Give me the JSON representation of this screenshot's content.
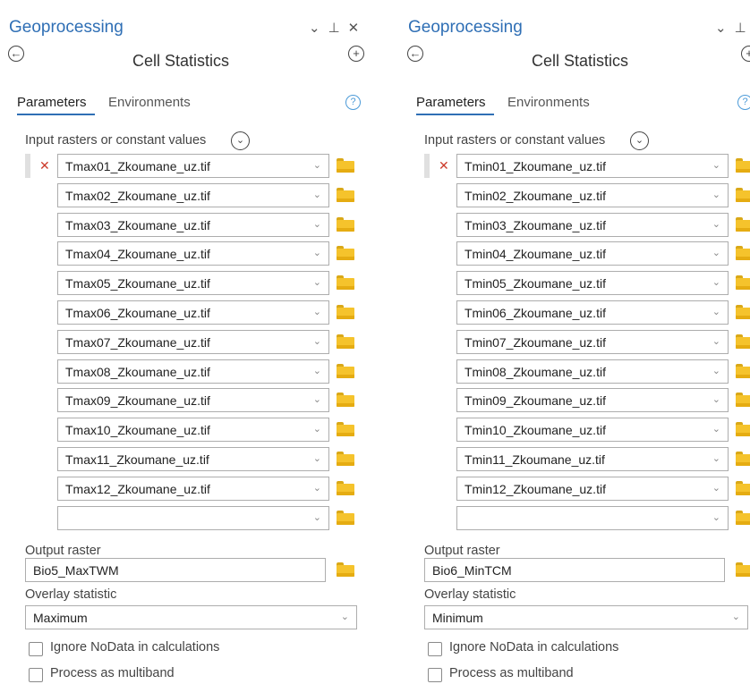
{
  "left": {
    "pane_title": "Geoprocessing",
    "tool_title": "Cell Statistics",
    "tabs": {
      "parameters": "Parameters",
      "environments": "Environments"
    },
    "input_label": "Input rasters or constant values",
    "rasters": [
      "Tmax01_Zkoumane_uz.tif",
      "Tmax02_Zkoumane_uz.tif",
      "Tmax03_Zkoumane_uz.tif",
      "Tmax04_Zkoumane_uz.tif",
      "Tmax05_Zkoumane_uz.tif",
      "Tmax06_Zkoumane_uz.tif",
      "Tmax07_Zkoumane_uz.tif",
      "Tmax08_Zkoumane_uz.tif",
      "Tmax09_Zkoumane_uz.tif",
      "Tmax10_Zkoumane_uz.tif",
      "Tmax11_Zkoumane_uz.tif",
      "Tmax12_Zkoumane_uz.tif",
      ""
    ],
    "output_label": "Output raster",
    "output_value": "Bio5_MaxTWM",
    "statistic_label": "Overlay statistic",
    "statistic_value": "Maximum",
    "ignore_nodata_label": "Ignore NoData in calculations",
    "ignore_nodata_checked": false,
    "multiband_label": "Process as multiband",
    "multiband_checked": false
  },
  "right": {
    "pane_title": "Geoprocessing",
    "tool_title": "Cell Statistics",
    "tabs": {
      "parameters": "Parameters",
      "environments": "Environments"
    },
    "input_label": "Input rasters or constant values",
    "rasters": [
      "Tmin01_Zkoumane_uz.tif",
      "Tmin02_Zkoumane_uz.tif",
      "Tmin03_Zkoumane_uz.tif",
      "Tmin04_Zkoumane_uz.tif",
      "Tmin05_Zkoumane_uz.tif",
      "Tmin06_Zkoumane_uz.tif",
      "Tmin07_Zkoumane_uz.tif",
      "Tmin08_Zkoumane_uz.tif",
      "Tmin09_Zkoumane_uz.tif",
      "Tmin10_Zkoumane_uz.tif",
      "Tmin11_Zkoumane_uz.tif",
      "Tmin12_Zkoumane_uz.tif",
      ""
    ],
    "output_label": "Output raster",
    "output_value": "Bio6_MinTCM",
    "statistic_label": "Overlay statistic",
    "statistic_value": "Minimum",
    "ignore_nodata_label": "Ignore NoData in calculations",
    "ignore_nodata_checked": false,
    "multiband_label": "Process as multiband",
    "multiband_checked": false
  },
  "icons": {
    "collapse": "chevron-down-icon",
    "pin": "pin-icon",
    "close": "close-icon",
    "back": "back-arrow-icon",
    "add": "add-icon",
    "help": "help-icon",
    "expand": "expand-icon",
    "remove": "remove-icon",
    "browse": "folder-icon"
  },
  "colors": {
    "accent": "#2f6fb5",
    "remove": "#cc3b2b",
    "folder": "#f5c32c"
  }
}
